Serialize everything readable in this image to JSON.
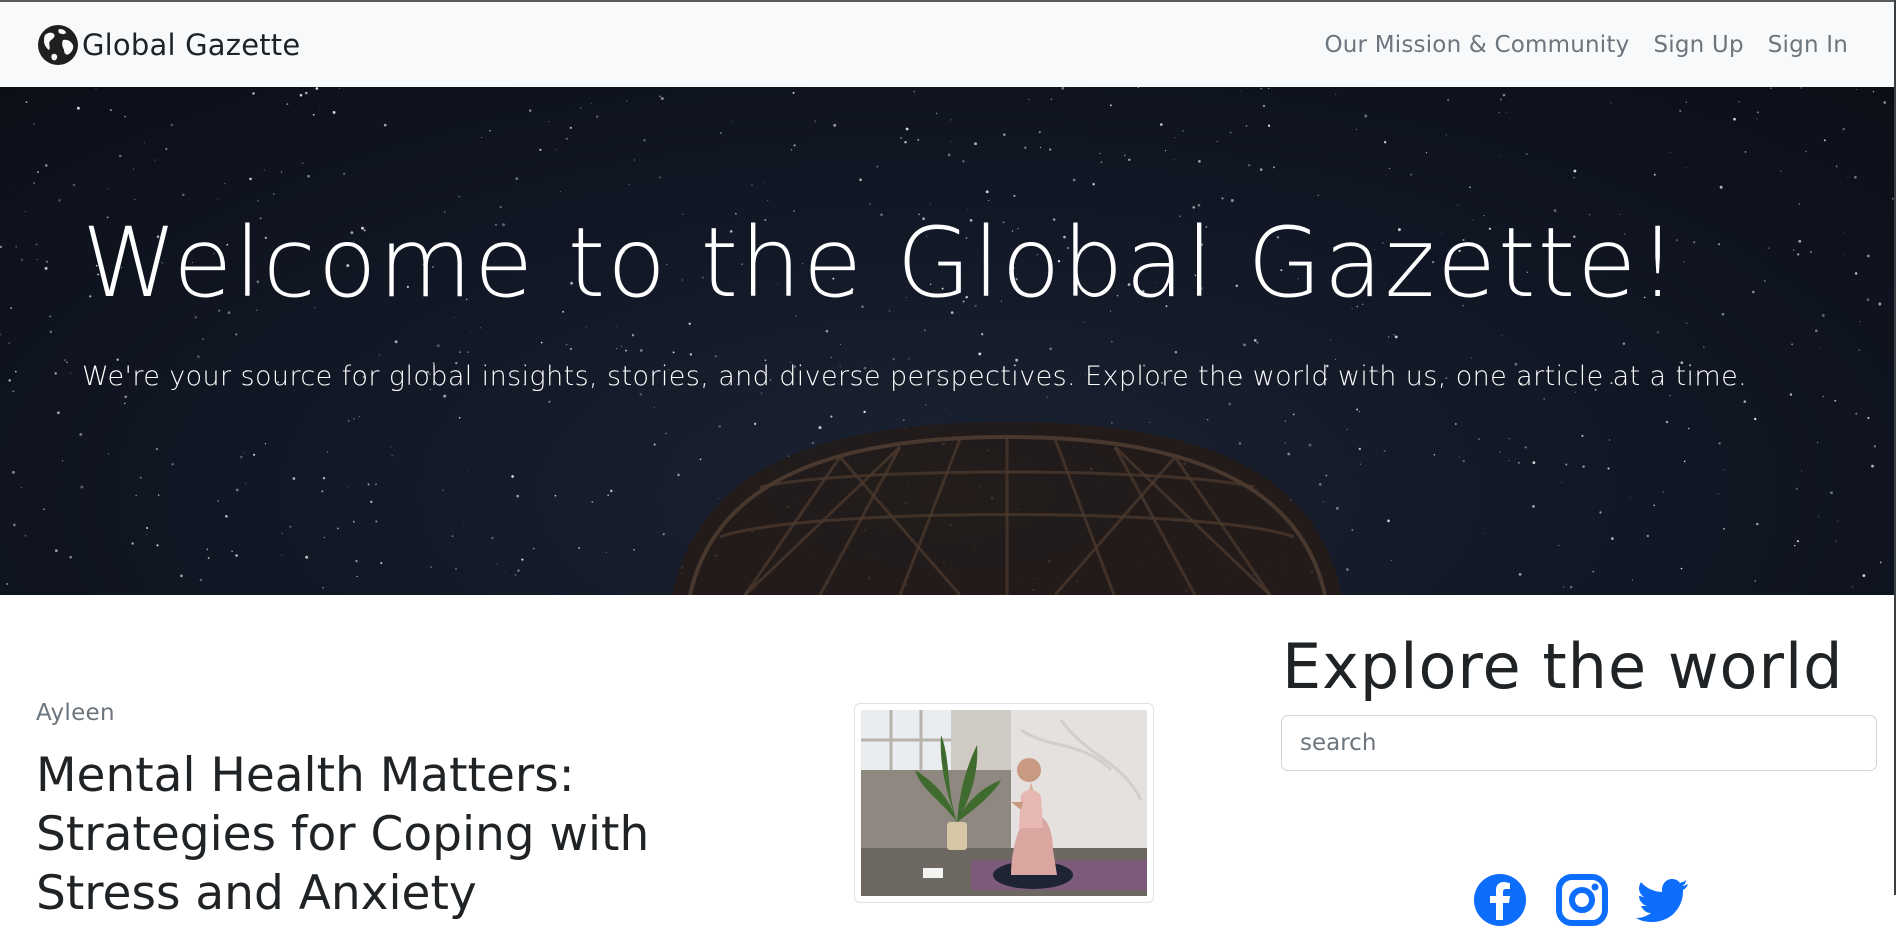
{
  "navbar": {
    "brand_name": "Global Gazette",
    "brand_icon": "globe-icon",
    "links": [
      {
        "label": "Our Mission & Community"
      },
      {
        "label": "Sign Up"
      },
      {
        "label": "Sign In"
      }
    ]
  },
  "hero": {
    "title": "Welcome to the Global Gazette!",
    "subtitle": "We're your source for global insights, stories, and diverse perspectives. Explore the world with us, one article at a time."
  },
  "article": {
    "author": "Ayleen",
    "title": "Mental Health Matters: Strategies for Coping with Stress and Anxiety"
  },
  "sidebar": {
    "heading": "Explore the world",
    "search_placeholder": "search",
    "social_icons": [
      "facebook-icon",
      "instagram-icon",
      "twitter-icon"
    ]
  },
  "colors": {
    "navbar_bg": "#f8f9fa",
    "nav_link": "#6c757d",
    "hero_bg": "#121826",
    "social_blue": "#0d6efd"
  }
}
